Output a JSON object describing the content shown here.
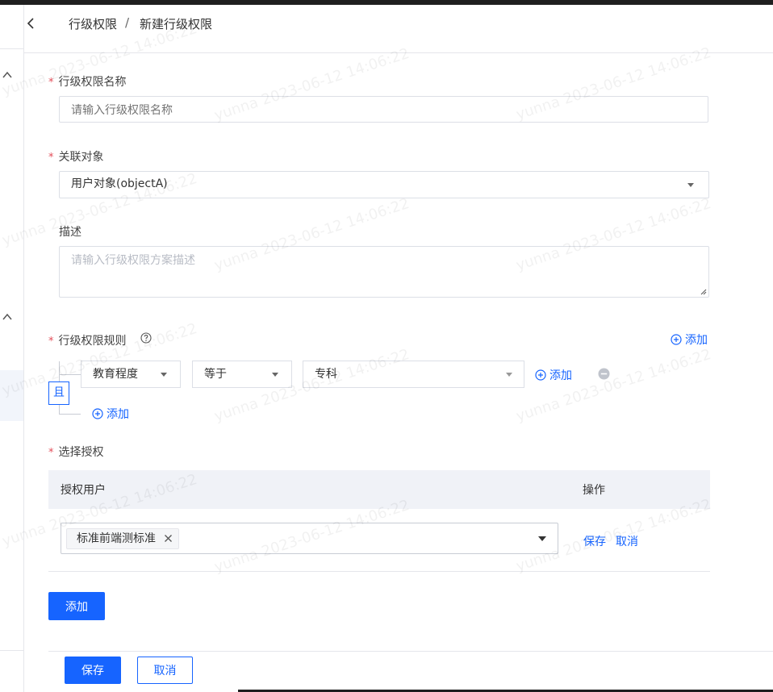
{
  "breadcrumb": {
    "parent": "行级权限",
    "separator": "/",
    "current": "新建行级权限"
  },
  "watermark": "yunna 2023-06-12 14:06:22",
  "form": {
    "name": {
      "label": "行级权限名称",
      "placeholder": "请输入行级权限名称"
    },
    "object": {
      "label": "关联对象",
      "value": "用户对象(objectA)"
    },
    "desc": {
      "label": "描述",
      "placeholder": "请输入行级权限方案描述"
    },
    "rules": {
      "label": "行级权限规则",
      "add_top": "添加",
      "logic": "且",
      "condition": {
        "field": "教育程度",
        "operator": "等于",
        "value": "专科",
        "add": "添加"
      },
      "add_bottom": "添加"
    },
    "auth": {
      "label": "选择授权",
      "columns": [
        "授权用户",
        "操作"
      ],
      "row": {
        "tag": "标准前端测标准",
        "save": "保存",
        "cancel": "取消"
      },
      "add_button": "添加"
    }
  },
  "footer": {
    "save": "保存",
    "cancel": "取消"
  },
  "colors": {
    "primary": "#1664ff",
    "required": "#e34d59",
    "table_head": "#f0f2f7"
  }
}
